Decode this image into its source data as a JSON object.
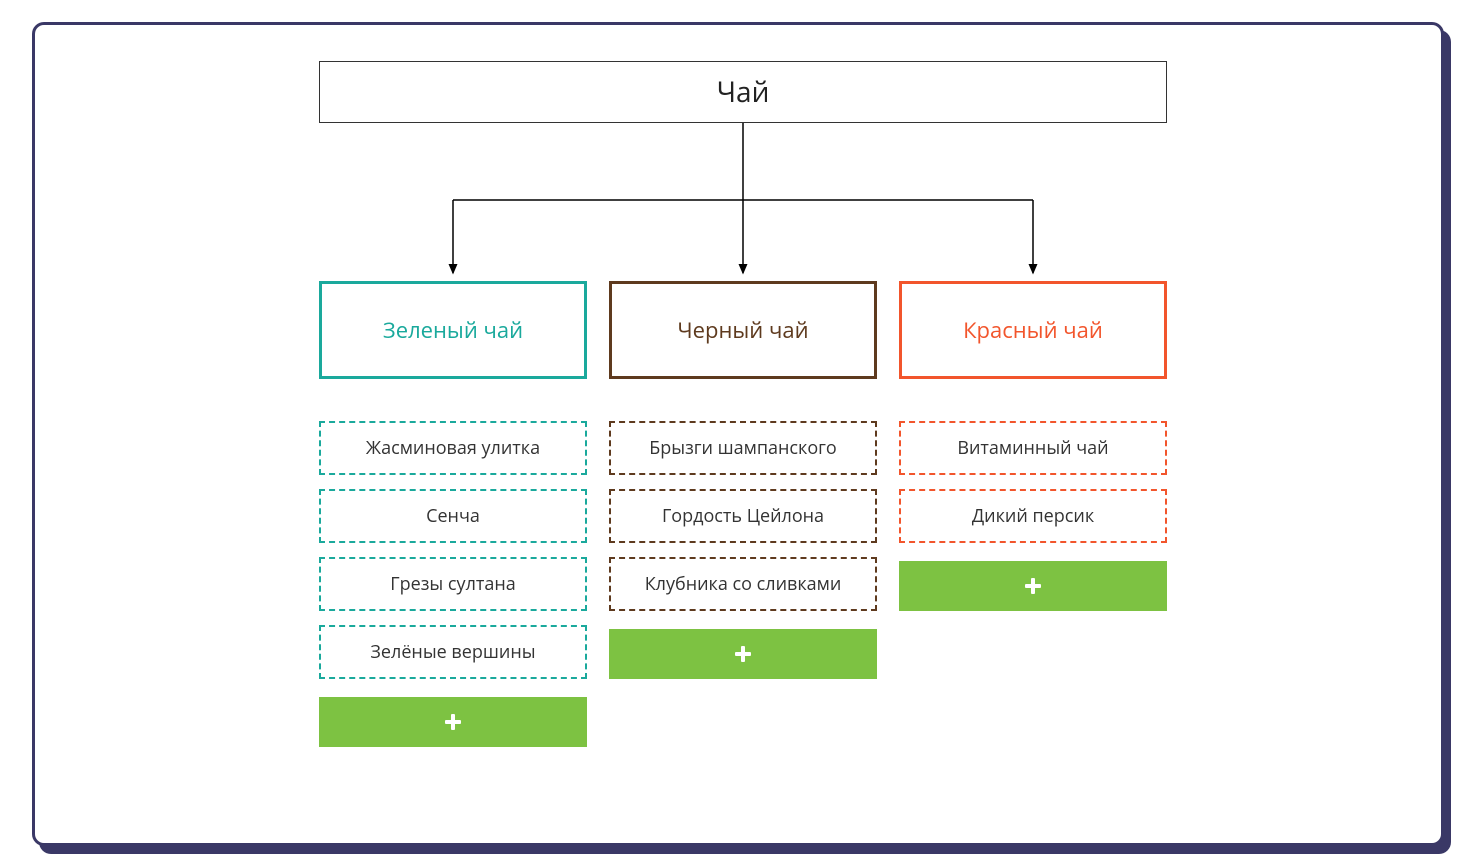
{
  "root": {
    "label": "Чай"
  },
  "categories": [
    {
      "key": "green",
      "label": "Зеленый чай",
      "color": "#1aa99c",
      "items": [
        "Жасминовая улитка",
        "Сенча",
        "Грезы султана",
        "Зелёные вершины"
      ]
    },
    {
      "key": "black",
      "label": "Черный чай",
      "color": "#5e3a1e",
      "items": [
        "Брызги шампанского",
        "Гордость Цейлона",
        "Клубника со сливками"
      ]
    },
    {
      "key": "red",
      "label": "Красный чай",
      "color": "#f2552c",
      "items": [
        "Витаминный чай",
        "Дикий персик"
      ]
    }
  ],
  "colors": {
    "add_button": "#7dc242",
    "frame_border": "#3a3866"
  }
}
